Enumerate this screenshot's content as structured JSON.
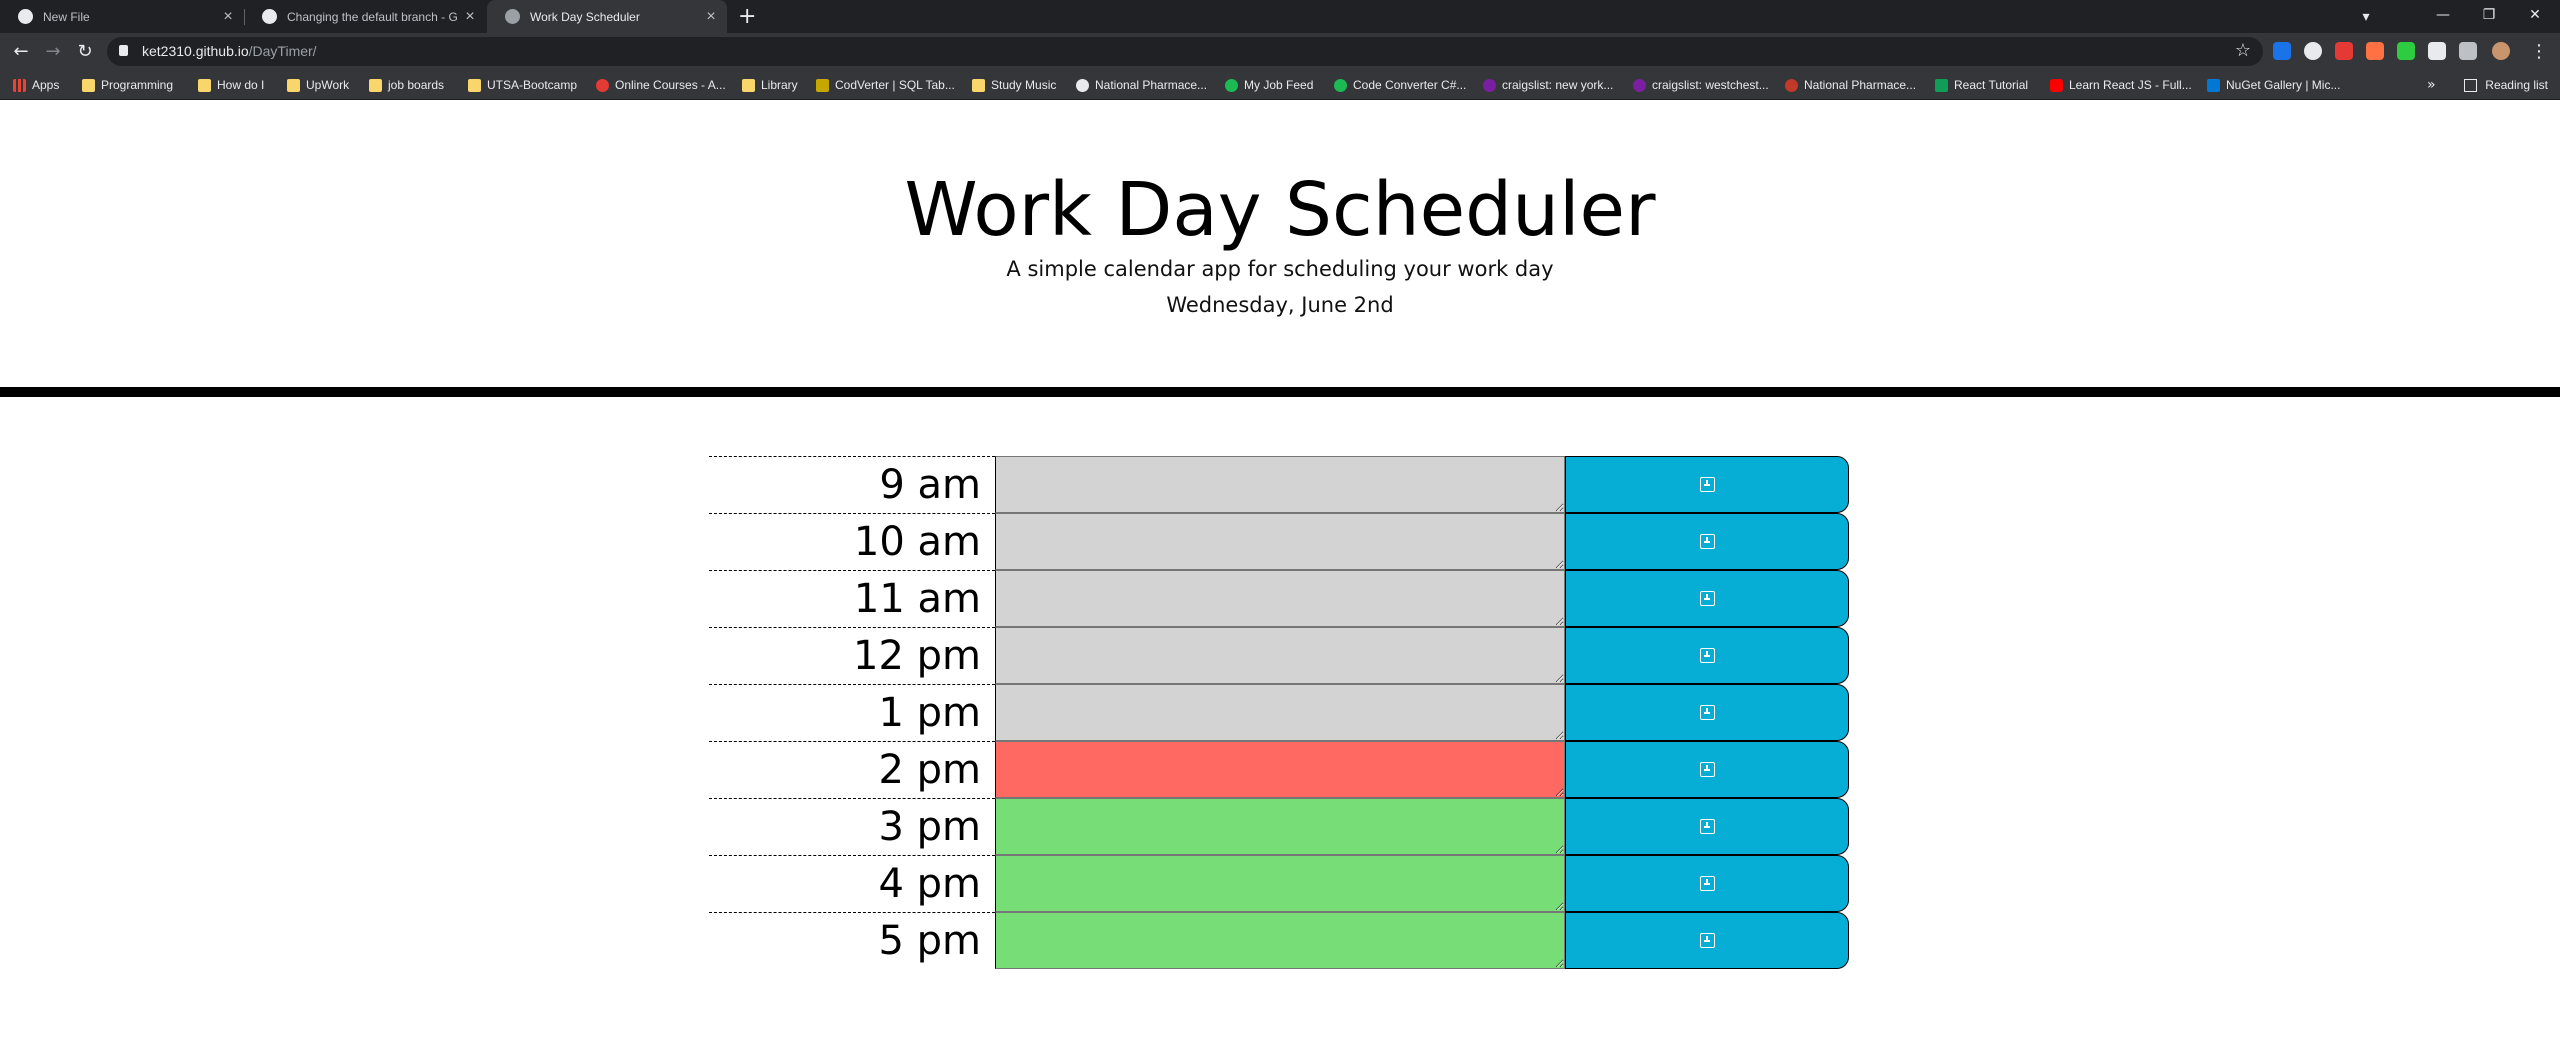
{
  "browser": {
    "tabs": [
      {
        "title": "New File",
        "active": false
      },
      {
        "title": "Changing the default branch - G",
        "active": false
      },
      {
        "title": "Work Day Scheduler",
        "active": true
      }
    ],
    "new_tab_label": "+",
    "url": {
      "host": "ket2310.github.io",
      "path": "/DayTimer/"
    },
    "bookmarks": [
      {
        "label": "Apps",
        "icon": "apps-icon"
      },
      {
        "label": "Programming",
        "icon": "folder-icon"
      },
      {
        "label": "How do I",
        "icon": "folder-icon"
      },
      {
        "label": "UpWork",
        "icon": "folder-icon"
      },
      {
        "label": "job boards",
        "icon": "folder-icon"
      },
      {
        "label": "UTSA-Bootcamp",
        "icon": "folder-icon"
      },
      {
        "label": "Online Courses - A...",
        "icon": "udemy-icon"
      },
      {
        "label": "Library",
        "icon": "folder-icon"
      },
      {
        "label": "CodVerter | SQL Tab...",
        "icon": "codverter-icon"
      },
      {
        "label": "Study Music",
        "icon": "folder-icon"
      },
      {
        "label": "National Pharmace...",
        "icon": "globe-icon"
      },
      {
        "label": "My Job Feed",
        "icon": "upwork-icon"
      },
      {
        "label": "Code Converter C#...",
        "icon": "converter-icon"
      },
      {
        "label": "craigslist: new york...",
        "icon": "craigslist-icon"
      },
      {
        "label": "craigslist: westchest...",
        "icon": "craigslist-icon"
      },
      {
        "label": "National Pharmace...",
        "icon": "pharmacy-icon"
      },
      {
        "label": "React Tutorial",
        "icon": "react-tutorial-icon"
      },
      {
        "label": "Learn React JS - Full...",
        "icon": "youtube-icon"
      },
      {
        "label": "NuGet Gallery | Mic...",
        "icon": "nuget-icon"
      }
    ],
    "more_bookmarks": "»",
    "reading_list": "Reading list"
  },
  "header": {
    "title": "Work Day Scheduler",
    "lead": "A simple calendar app for scheduling your work day",
    "current_day": "Wednesday, June 2nd"
  },
  "scheduler": {
    "rows": [
      {
        "hour": "9 am",
        "state": "past",
        "text": ""
      },
      {
        "hour": "10 am",
        "state": "past",
        "text": ""
      },
      {
        "hour": "11 am",
        "state": "past",
        "text": ""
      },
      {
        "hour": "12 pm",
        "state": "past",
        "text": ""
      },
      {
        "hour": "1 pm",
        "state": "past",
        "text": ""
      },
      {
        "hour": "2 pm",
        "state": "present",
        "text": ""
      },
      {
        "hour": "3 pm",
        "state": "future",
        "text": ""
      },
      {
        "hour": "4 pm",
        "state": "future",
        "text": ""
      },
      {
        "hour": "5 pm",
        "state": "future",
        "text": ""
      }
    ],
    "colors": {
      "past": "#d3d3d3",
      "present": "#ff6961",
      "future": "#77dd77",
      "save": "#06aed5"
    },
    "save_icon": "save-icon"
  }
}
